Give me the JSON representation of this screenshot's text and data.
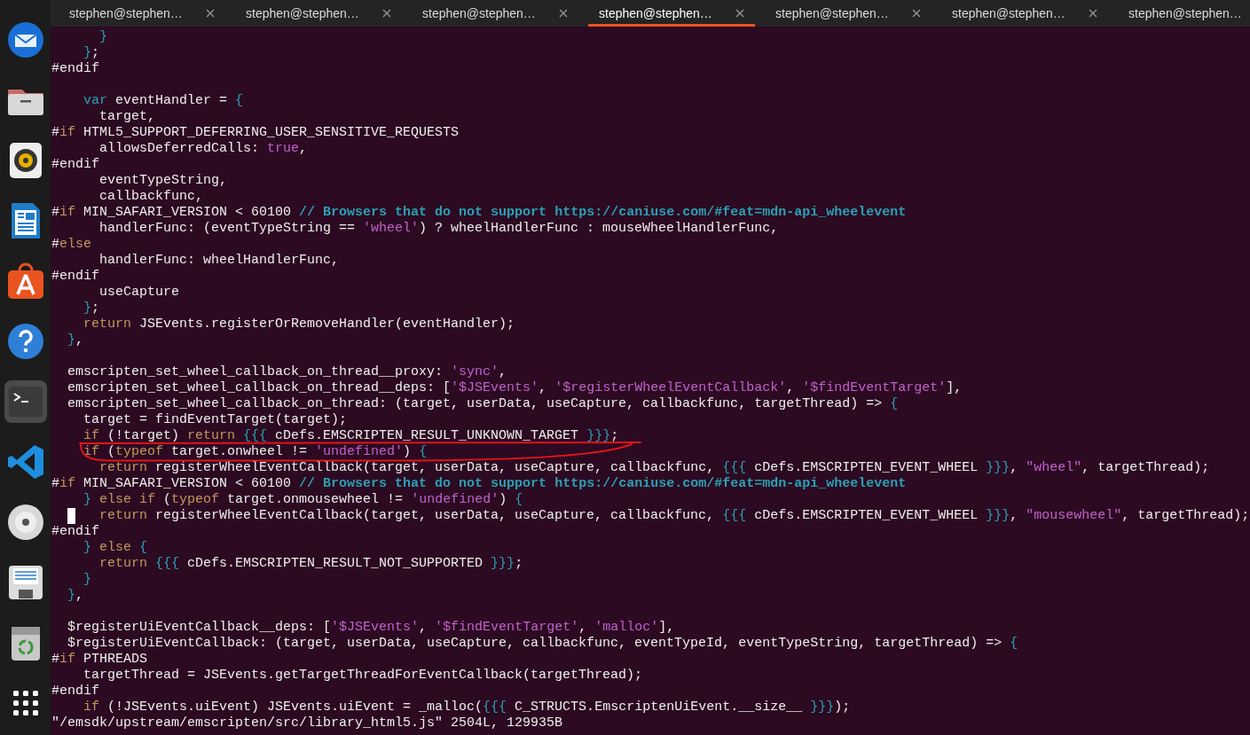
{
  "dock": {
    "items": [
      {
        "kind": "mail",
        "selected": false
      },
      {
        "kind": "files",
        "selected": false
      },
      {
        "kind": "music",
        "selected": false
      },
      {
        "kind": "writer",
        "selected": false
      },
      {
        "kind": "store",
        "selected": false
      },
      {
        "kind": "help",
        "selected": false
      },
      {
        "kind": "terminal",
        "selected": true
      },
      {
        "kind": "code",
        "selected": false
      },
      {
        "kind": "disc",
        "selected": false
      },
      {
        "kind": "save",
        "selected": false
      },
      {
        "kind": "trash",
        "selected": false
      },
      {
        "kind": "apps",
        "selected": false
      }
    ]
  },
  "tabs": [
    {
      "label": "stephen@stephen…",
      "selected": false
    },
    {
      "label": "stephen@stephen…",
      "selected": false
    },
    {
      "label": "stephen@stephen…",
      "selected": false
    },
    {
      "label": "stephen@stephen…",
      "selected": true
    },
    {
      "label": "stephen@stephen…",
      "selected": false
    },
    {
      "label": "stephen@stephen…",
      "selected": false
    },
    {
      "label": "stephen@stephen…",
      "selected": false
    }
  ],
  "editor": {
    "lines": [
      {
        "kind": "code",
        "segments": [
          {
            "kind": "brace",
            "text": "      }"
          }
        ]
      },
      {
        "kind": "code",
        "segments": [
          {
            "kind": "brace",
            "text": "    }"
          },
          {
            "kind": "plain",
            "text": ";"
          }
        ]
      },
      {
        "kind": "code",
        "segments": [
          {
            "kind": "plain",
            "text": "#endif"
          }
        ]
      },
      {
        "kind": "blank"
      },
      {
        "kind": "code",
        "segments": [
          {
            "kind": "statement",
            "text": "    var"
          },
          {
            "kind": "plain",
            "text": " eventHandler ="
          },
          {
            "kind": "brace",
            "text": " {"
          }
        ]
      },
      {
        "kind": "code",
        "segments": [
          {
            "kind": "plain",
            "text": "      target,"
          }
        ]
      },
      {
        "kind": "code",
        "segments": [
          {
            "kind": "plain",
            "text": "#"
          },
          {
            "kind": "keyword",
            "text": "if"
          },
          {
            "kind": "plain",
            "text": " HTML5_SUPPORT_DEFERRING_USER_SENSITIVE_REQUESTS"
          }
        ]
      },
      {
        "kind": "code",
        "segments": [
          {
            "kind": "plain",
            "text": "      allowsDeferredCalls:"
          },
          {
            "kind": "constant",
            "text": " true"
          },
          {
            "kind": "plain",
            "text": ","
          }
        ]
      },
      {
        "kind": "code",
        "segments": [
          {
            "kind": "plain",
            "text": "#endif"
          }
        ]
      },
      {
        "kind": "code",
        "segments": [
          {
            "kind": "plain",
            "text": "      eventTypeString,"
          }
        ]
      },
      {
        "kind": "code",
        "segments": [
          {
            "kind": "plain",
            "text": "      callbackfunc,"
          }
        ]
      },
      {
        "kind": "code",
        "segments": [
          {
            "kind": "plain",
            "text": "#"
          },
          {
            "kind": "keyword",
            "text": "if"
          },
          {
            "kind": "plain",
            "text": " MIN_SAFARI_VERSION < 60100"
          },
          {
            "kind": "comment",
            "text": " // Browsers that do not support https://caniuse.com/#feat=mdn-api_wheelevent"
          }
        ]
      },
      {
        "kind": "code",
        "segments": [
          {
            "kind": "plain",
            "text": "      handlerFunc: (eventTypeString =="
          },
          {
            "kind": "string",
            "text": " 'wheel'"
          },
          {
            "kind": "plain",
            "text": ") ? wheelHandlerFunc : mouseWheelHandlerFunc,"
          }
        ]
      },
      {
        "kind": "code",
        "segments": [
          {
            "kind": "plain",
            "text": "#"
          },
          {
            "kind": "keyword",
            "text": "else"
          }
        ]
      },
      {
        "kind": "code",
        "segments": [
          {
            "kind": "plain",
            "text": "      handlerFunc: wheelHandlerFunc,"
          }
        ]
      },
      {
        "kind": "code",
        "segments": [
          {
            "kind": "plain",
            "text": "#endif"
          }
        ]
      },
      {
        "kind": "code",
        "segments": [
          {
            "kind": "plain",
            "text": "      useCapture"
          }
        ]
      },
      {
        "kind": "code",
        "segments": [
          {
            "kind": "brace",
            "text": "    }"
          },
          {
            "kind": "plain",
            "text": ";"
          }
        ]
      },
      {
        "kind": "code",
        "segments": [
          {
            "kind": "keyword",
            "text": "    return"
          },
          {
            "kind": "plain",
            "text": " JSEvents.registerOrRemoveHandler(eventHandler);"
          }
        ]
      },
      {
        "kind": "code",
        "segments": [
          {
            "kind": "brace",
            "text": "  }"
          },
          {
            "kind": "plain",
            "text": ","
          }
        ]
      },
      {
        "kind": "blank"
      },
      {
        "kind": "code",
        "segments": [
          {
            "kind": "plain",
            "text": "  emscripten_set_wheel_callback_on_thread__proxy:"
          },
          {
            "kind": "string",
            "text": " 'sync'"
          },
          {
            "kind": "plain",
            "text": ","
          }
        ]
      },
      {
        "kind": "code",
        "segments": [
          {
            "kind": "plain",
            "text": "  emscripten_set_wheel_callback_on_thread__deps: ["
          },
          {
            "kind": "string",
            "text": "'$JSEvents'"
          },
          {
            "kind": "plain",
            "text": ","
          },
          {
            "kind": "string",
            "text": " '$registerWheelEventCallback'"
          },
          {
            "kind": "plain",
            "text": ","
          },
          {
            "kind": "string",
            "text": " '$findEventTarget'"
          },
          {
            "kind": "plain",
            "text": "],"
          }
        ]
      },
      {
        "kind": "code",
        "segments": [
          {
            "kind": "plain",
            "text": "  emscripten_set_wheel_callback_on_thread: (target, userData, useCapture, callbackfunc, targetThread) =>"
          },
          {
            "kind": "brace",
            "text": " {"
          }
        ]
      },
      {
        "kind": "code",
        "segments": [
          {
            "kind": "plain",
            "text": "    target = findEventTarget(target);"
          }
        ]
      },
      {
        "kind": "code",
        "segments": [
          {
            "kind": "keyword",
            "text": "    if"
          },
          {
            "kind": "plain",
            "text": " (!target)"
          },
          {
            "kind": "keyword",
            "text": " return"
          },
          {
            "kind": "brace",
            "text": " {{{"
          },
          {
            "kind": "plain",
            "text": " cDefs.EMSCRIPTEN_RESULT_UNKNOWN_TARGET"
          },
          {
            "kind": "brace",
            "text": " }}}"
          },
          {
            "kind": "plain",
            "text": ";"
          }
        ]
      },
      {
        "kind": "code",
        "segments": [
          {
            "kind": "keyword",
            "text": "    if"
          },
          {
            "kind": "plain",
            "text": " ("
          },
          {
            "kind": "keyword",
            "text": "typeof"
          },
          {
            "kind": "plain",
            "text": " target.onwheel !="
          },
          {
            "kind": "string",
            "text": " 'undefined'"
          },
          {
            "kind": "plain",
            "text": ")"
          },
          {
            "kind": "brace",
            "text": " {"
          }
        ]
      },
      {
        "kind": "code",
        "segments": [
          {
            "kind": "keyword",
            "text": "      return"
          },
          {
            "kind": "plain",
            "text": " registerWheelEventCallback(target, userData, useCapture, callbackfunc,"
          },
          {
            "kind": "brace",
            "text": " {{{"
          },
          {
            "kind": "plain",
            "text": " cDefs.EMSCRIPTEN_EVENT_WHEEL"
          },
          {
            "kind": "brace",
            "text": " }}}"
          },
          {
            "kind": "plain",
            "text": ","
          },
          {
            "kind": "string",
            "text": " \"wheel\""
          },
          {
            "kind": "plain",
            "text": ", targetThread);"
          }
        ]
      },
      {
        "kind": "code",
        "segments": [
          {
            "kind": "plain",
            "text": "#"
          },
          {
            "kind": "keyword",
            "text": "if"
          },
          {
            "kind": "plain",
            "text": " MIN_SAFARI_VERSION < 60100"
          },
          {
            "kind": "comment",
            "text": " // Browsers that do not support https://caniuse.com/#feat=mdn-api_wheelevent"
          }
        ]
      },
      {
        "kind": "code",
        "segments": [
          {
            "kind": "brace",
            "text": "    }"
          },
          {
            "kind": "keyword",
            "text": " else"
          },
          {
            "kind": "keyword",
            "text": " if"
          },
          {
            "kind": "plain",
            "text": " ("
          },
          {
            "kind": "keyword",
            "text": "typeof"
          },
          {
            "kind": "plain",
            "text": " target.onmousewheel !="
          },
          {
            "kind": "string",
            "text": " 'undefined'"
          },
          {
            "kind": "plain",
            "text": ")"
          },
          {
            "kind": "brace",
            "text": " {"
          }
        ]
      },
      {
        "kind": "code",
        "cursor": true,
        "segments": [
          {
            "kind": "keyword",
            "text": "   return"
          },
          {
            "kind": "plain",
            "text": " registerWheelEventCallback(target, userData, useCapture, callbackfunc,"
          },
          {
            "kind": "brace",
            "text": " {{{"
          },
          {
            "kind": "plain",
            "text": " cDefs.EMSCRIPTEN_EVENT_WHEEL"
          },
          {
            "kind": "brace",
            "text": " }}}"
          },
          {
            "kind": "plain",
            "text": ","
          },
          {
            "kind": "string",
            "text": " \"mousewheel\""
          },
          {
            "kind": "plain",
            "text": ", targetThread);"
          }
        ]
      },
      {
        "kind": "code",
        "segments": [
          {
            "kind": "plain",
            "text": "#endif"
          }
        ]
      },
      {
        "kind": "code",
        "segments": [
          {
            "kind": "brace",
            "text": "    }"
          },
          {
            "kind": "keyword",
            "text": " else"
          },
          {
            "kind": "brace",
            "text": " {"
          }
        ]
      },
      {
        "kind": "code",
        "segments": [
          {
            "kind": "keyword",
            "text": "      return"
          },
          {
            "kind": "brace",
            "text": " {{{"
          },
          {
            "kind": "plain",
            "text": " cDefs.EMSCRIPTEN_RESULT_NOT_SUPPORTED"
          },
          {
            "kind": "brace",
            "text": " }}}"
          },
          {
            "kind": "plain",
            "text": ";"
          }
        ]
      },
      {
        "kind": "code",
        "segments": [
          {
            "kind": "brace",
            "text": "    }"
          }
        ]
      },
      {
        "kind": "code",
        "segments": [
          {
            "kind": "brace",
            "text": "  }"
          },
          {
            "kind": "plain",
            "text": ","
          }
        ]
      },
      {
        "kind": "blank"
      },
      {
        "kind": "code",
        "segments": [
          {
            "kind": "plain",
            "text": "  $registerUiEventCallback__deps: ["
          },
          {
            "kind": "string",
            "text": "'$JSEvents'"
          },
          {
            "kind": "plain",
            "text": ","
          },
          {
            "kind": "string",
            "text": " '$findEventTarget'"
          },
          {
            "kind": "plain",
            "text": ","
          },
          {
            "kind": "string",
            "text": " 'malloc'"
          },
          {
            "kind": "plain",
            "text": "],"
          }
        ]
      },
      {
        "kind": "code",
        "segments": [
          {
            "kind": "plain",
            "text": "  $registerUiEventCallback: (target, userData, useCapture, callbackfunc, eventTypeId, eventTypeString, targetThread) =>"
          },
          {
            "kind": "brace",
            "text": " {"
          }
        ]
      },
      {
        "kind": "code",
        "segments": [
          {
            "kind": "plain",
            "text": "#"
          },
          {
            "kind": "keyword",
            "text": "if"
          },
          {
            "kind": "plain",
            "text": " PTHREADS"
          }
        ]
      },
      {
        "kind": "code",
        "segments": [
          {
            "kind": "plain",
            "text": "    targetThread = JSEvents.getTargetThreadForEventCallback(targetThread);"
          }
        ]
      },
      {
        "kind": "code",
        "segments": [
          {
            "kind": "plain",
            "text": "#endif"
          }
        ]
      },
      {
        "kind": "code",
        "segments": [
          {
            "kind": "keyword",
            "text": "    if"
          },
          {
            "kind": "plain",
            "text": " (!JSEvents.uiEvent) JSEvents.uiEvent = _malloc("
          },
          {
            "kind": "brace",
            "text": "{{{"
          },
          {
            "kind": "plain",
            "text": " C_STRUCTS.EmscriptenUiEvent.__size__"
          },
          {
            "kind": "brace",
            "text": " }}}"
          },
          {
            "kind": "plain",
            "text": ");"
          }
        ]
      }
    ]
  },
  "status_bar": {
    "text": "\"/emsdk/upstream/emscripten/src/library_html5.js\" 2504L, 129935B"
  }
}
